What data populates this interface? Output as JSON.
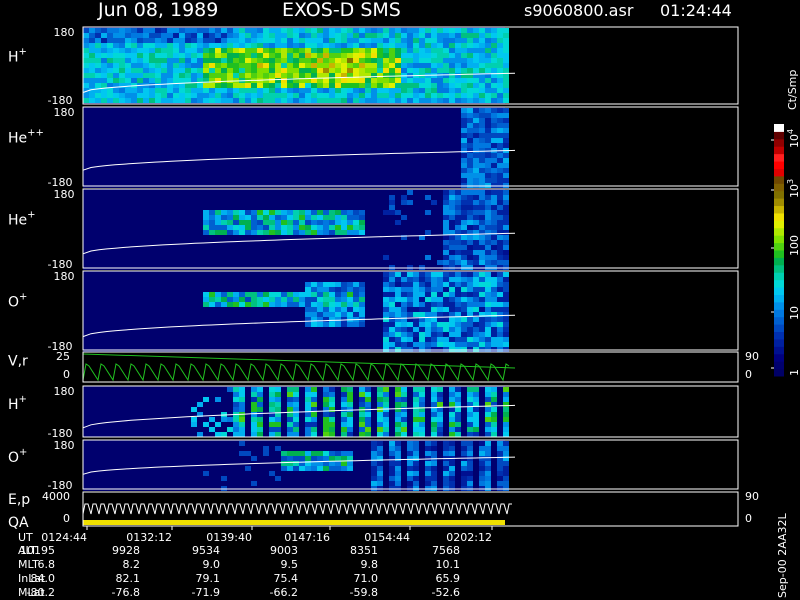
{
  "header": {
    "date": "Jun 08, 1989",
    "instrument": "EXOS-D SMS",
    "file": "s9060800.asr",
    "time": "01:24:44"
  },
  "colorbar": {
    "title": "Ct/Smp",
    "ticks": [
      "1",
      "10",
      "100",
      "10",
      "10"
    ],
    "tick_exponents": [
      "",
      "",
      "",
      "3",
      "4"
    ],
    "colors": [
      "#000066",
      "#00006e",
      "#000080",
      "#001090",
      "#0020a0",
      "#0030b0",
      "#0048c0",
      "#0060d0",
      "#0078e0",
      "#0090e8",
      "#00b0f0",
      "#00c8f0",
      "#00d8d8",
      "#00d0b0",
      "#00c080",
      "#00b050",
      "#20c020",
      "#50d010",
      "#80e000",
      "#b0e800",
      "#e0f000",
      "#f0e000",
      "#c8b400",
      "#a08c00",
      "#807000",
      "#806000",
      "#704800",
      "#e00000",
      "#ff0000",
      "#ff2020",
      "#c00000",
      "#900000",
      "#600000",
      "#ffffff"
    ]
  },
  "footer": {
    "stamp": "Sep-00 2AA32L",
    "row_labels": [
      "UT",
      "ALT",
      "MLT",
      "InLat",
      "MLat"
    ],
    "columns": [
      [
        "0124:44",
        "10195",
        "6.8",
        "84.0",
        "-80.2"
      ],
      [
        "0132:12",
        "9928",
        "8.2",
        "82.1",
        "-76.8"
      ],
      [
        "0139:40",
        "9534",
        "9.0",
        "79.1",
        "-71.9"
      ],
      [
        "0147:16",
        "9003",
        "9.5",
        "75.4",
        "-66.2"
      ],
      [
        "0154:44",
        "8351",
        "9.8",
        "71.0",
        "-59.8"
      ],
      [
        "0202:12",
        "7568",
        "10.1",
        "65.9",
        "-52.6"
      ]
    ]
  },
  "chart_data": [
    {
      "type": "heatmap",
      "panel": "H+",
      "ylim": [
        -180,
        180
      ],
      "ytick_labels": [
        "180",
        "-180"
      ],
      "data_end_ut": "0202:12",
      "description_values": "intense broad flux across all times, highest mid-interval",
      "pitch_trace": "rising white line from about -100 to about 0"
    },
    {
      "type": "heatmap",
      "panel": "He++",
      "ylim": [
        -180,
        180
      ],
      "ytick_labels": [
        "180",
        "-180"
      ],
      "data_end_ut": "0202:12"
    },
    {
      "type": "heatmap",
      "panel": "He+",
      "ylim": [
        -180,
        180
      ],
      "ytick_labels": [
        "180",
        "-180"
      ],
      "data_end_ut": "0202:12"
    },
    {
      "type": "heatmap",
      "panel": "O+",
      "ylim": [
        -180,
        180
      ],
      "ytick_labels": [
        "180",
        "-180"
      ],
      "data_end_ut": "0202:12"
    },
    {
      "type": "line",
      "panel": "V,r",
      "left_ticks": [
        "25",
        "0"
      ],
      "right_ticks": [
        "90",
        "0"
      ]
    },
    {
      "type": "heatmap",
      "panel": "H+ (2)",
      "ylim": [
        -180,
        180
      ],
      "ytick_labels": [
        "180",
        "-180"
      ]
    },
    {
      "type": "heatmap",
      "panel": "O+ (2)",
      "ylim": [
        -180,
        180
      ],
      "ytick_labels": [
        "180",
        "-180"
      ]
    },
    {
      "type": "line",
      "panel": "E,p QA",
      "left_ticks": [
        "4000",
        "0"
      ],
      "right_ticks": [
        "90",
        "0"
      ]
    }
  ],
  "panels": [
    {
      "label": "H",
      "sup": "+"
    },
    {
      "label": "He",
      "sup": "++"
    },
    {
      "label": "He",
      "sup": "+"
    },
    {
      "label": "O",
      "sup": "+"
    },
    {
      "label": "V,r",
      "sup": ""
    },
    {
      "label": "H",
      "sup": "+"
    },
    {
      "label": "O",
      "sup": "+"
    },
    {
      "label": "E,p",
      "sup": "",
      "label2": "QA"
    }
  ]
}
